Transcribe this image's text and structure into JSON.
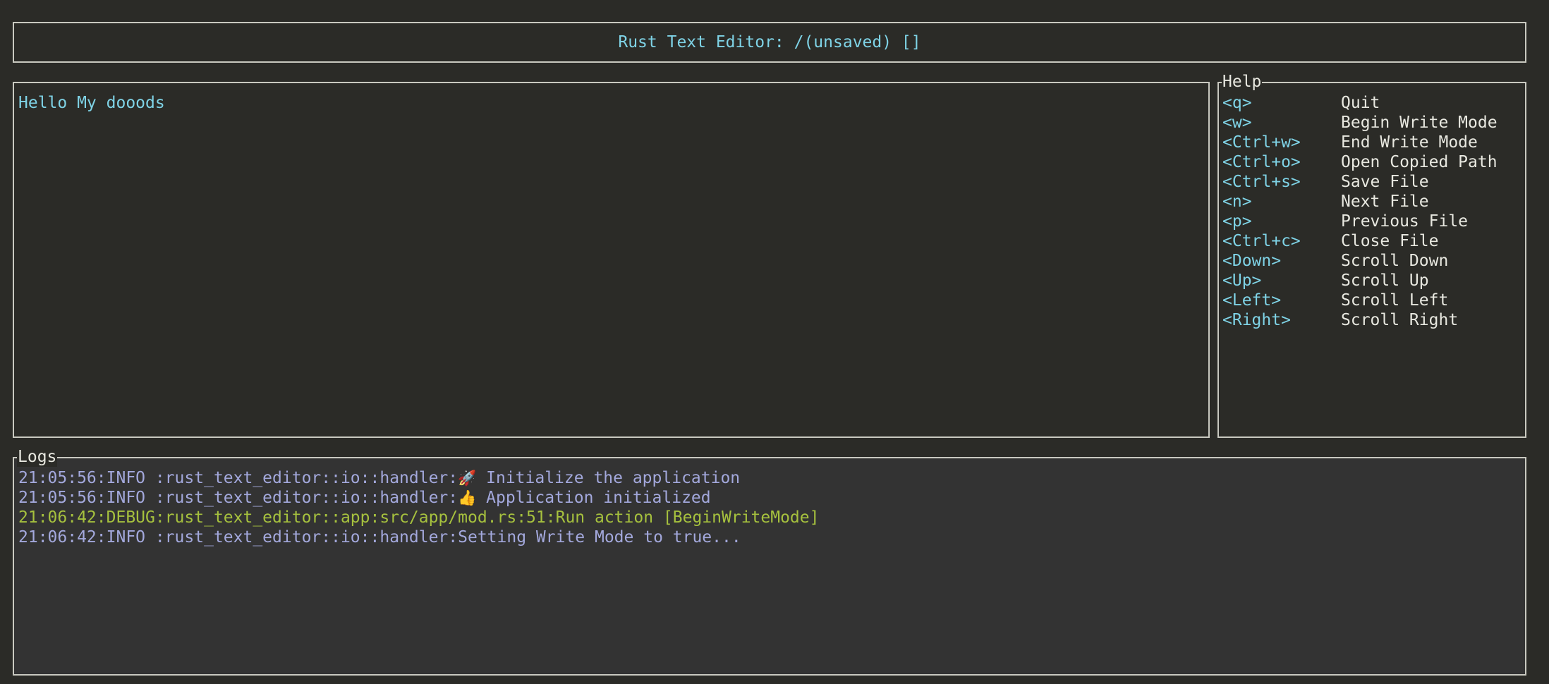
{
  "header": {
    "title": "Rust Text Editor: /(unsaved) []"
  },
  "editor": {
    "lines": [
      "Hello My dooods"
    ]
  },
  "help": {
    "title": "Help",
    "items": [
      {
        "key": "<q>",
        "action": "Quit"
      },
      {
        "key": "<w>",
        "action": "Begin Write Mode"
      },
      {
        "key": "<Ctrl+w>",
        "action": "End Write Mode"
      },
      {
        "key": "<Ctrl+o>",
        "action": "Open Copied Path"
      },
      {
        "key": "<Ctrl+s>",
        "action": "Save File"
      },
      {
        "key": "<n>",
        "action": "Next File"
      },
      {
        "key": "<p>",
        "action": "Previous File"
      },
      {
        "key": "<Ctrl+c>",
        "action": "Close File"
      },
      {
        "key": "<Down>",
        "action": "Scroll Down"
      },
      {
        "key": "<Up>",
        "action": "Scroll Up"
      },
      {
        "key": "<Left>",
        "action": "Scroll Left"
      },
      {
        "key": "<Right>",
        "action": "Scroll Right"
      }
    ]
  },
  "logs": {
    "title": "Logs",
    "entries": [
      {
        "prefix": "21:05:56:INFO :rust_text_editor::io::handler:",
        "icon": "rocket-icon",
        "glyph": "🚀",
        "message": " Initialize the application",
        "level": "info"
      },
      {
        "prefix": "21:05:56:INFO :rust_text_editor::io::handler:",
        "icon": "thumbs-up-icon",
        "glyph": "👍",
        "message": " Application initialized",
        "level": "info"
      },
      {
        "prefix": "21:06:42:DEBUG:rust_text_editor::app:src/app/mod.rs:51:Run action [BeginWriteMode]",
        "icon": "",
        "glyph": "",
        "message": "",
        "level": "debug"
      },
      {
        "prefix": "21:06:42:INFO :rust_text_editor::io::handler:Setting Write Mode to true...",
        "icon": "",
        "glyph": "",
        "message": "",
        "level": "info"
      }
    ]
  },
  "colors": {
    "background": "#2b2b27",
    "border": "#c9c9c0",
    "accent_cyan": "#7fd3e6",
    "log_info": "#a3a8dc",
    "log_debug": "#a6c13e",
    "logs_background": "#333333"
  }
}
